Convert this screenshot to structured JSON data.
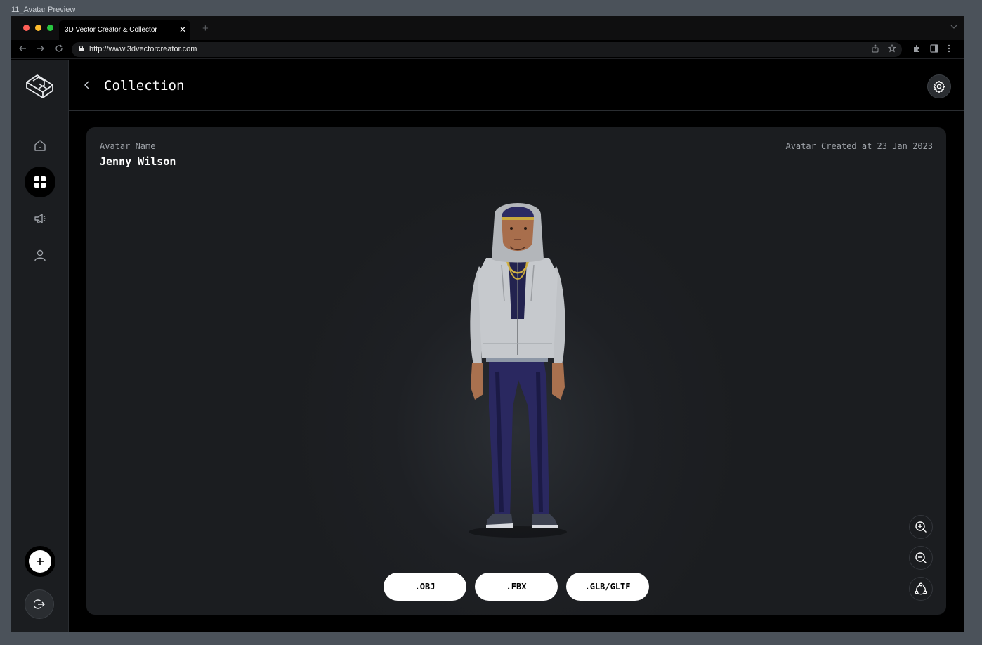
{
  "frame_label": "11_Avatar Preview",
  "browser": {
    "tab_title": "3D Vector Creator & Collector",
    "tab_close": "✕",
    "new_tab": "+",
    "url": "http://www.3dvectorcreator.com"
  },
  "colors": {
    "traffic_red": "#ff5f57",
    "traffic_yellow": "#febc2e",
    "traffic_green": "#28c840",
    "background": "#000000",
    "card": "#1e2024",
    "sidebar": "#1b1d20"
  },
  "sidebar": {
    "items": [
      {
        "icon": "home-icon"
      },
      {
        "icon": "grid-icon",
        "active": true
      },
      {
        "icon": "megaphone-icon"
      },
      {
        "icon": "user-icon"
      }
    ],
    "add_icon": "plus-icon",
    "logout_icon": "logout-icon"
  },
  "header": {
    "title": "Collection"
  },
  "avatar": {
    "name_label": "Avatar Name",
    "name": "Jenny Wilson",
    "created": "Avatar Created at 23 Jan 2023"
  },
  "formats": [
    ".OBJ",
    ".FBX",
    ".GLB/GLTF"
  ],
  "controls": [
    "zoom-in-icon",
    "zoom-out-icon",
    "rotate-3d-icon"
  ]
}
